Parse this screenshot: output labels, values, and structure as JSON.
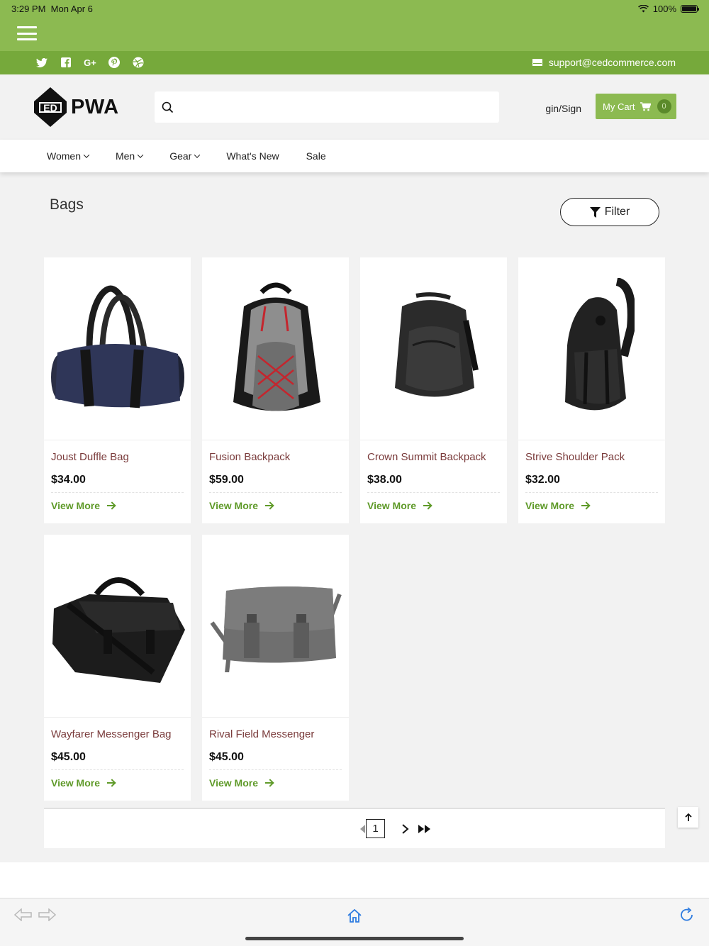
{
  "status_bar": {
    "time": "3:29 PM",
    "date": "Mon Apr 6",
    "battery": "100%"
  },
  "social": {
    "icons": [
      "twitter-icon",
      "facebook-icon",
      "google-plus-icon",
      "pinterest-icon",
      "dribbble-icon"
    ],
    "email": "support@cedcommerce.com"
  },
  "header": {
    "logo_text": "PWA",
    "search_placeholder": "",
    "signin_label": "gin/Sign",
    "cart_label": "My Cart",
    "cart_count": "0"
  },
  "nav": {
    "items": [
      {
        "label": "Women",
        "has_dropdown": true
      },
      {
        "label": "Men",
        "has_dropdown": true
      },
      {
        "label": "Gear",
        "has_dropdown": true
      },
      {
        "label": "What's New",
        "has_dropdown": false
      },
      {
        "label": "Sale",
        "has_dropdown": false
      }
    ]
  },
  "page": {
    "title": "Bags",
    "filter_label": "Filter"
  },
  "products": [
    {
      "name": "Joust Duffle Bag",
      "price": "$34.00",
      "cta": "View More"
    },
    {
      "name": "Fusion Backpack",
      "price": "$59.00",
      "cta": "View More"
    },
    {
      "name": "Crown Summit Backpack",
      "price": "$38.00",
      "cta": "View More"
    },
    {
      "name": "Strive Shoulder Pack",
      "price": "$32.00",
      "cta": "View More"
    },
    {
      "name": "Wayfarer Messenger Bag",
      "price": "$45.00",
      "cta": "View More"
    },
    {
      "name": "Rival Field Messenger",
      "price": "$45.00",
      "cta": "View More"
    }
  ],
  "pagination": {
    "current_page": "1"
  },
  "colors": {
    "brand_green": "#8cba51",
    "social_green": "#76a93b",
    "link_green": "#5f9a29",
    "product_name": "#7a3b3b"
  }
}
